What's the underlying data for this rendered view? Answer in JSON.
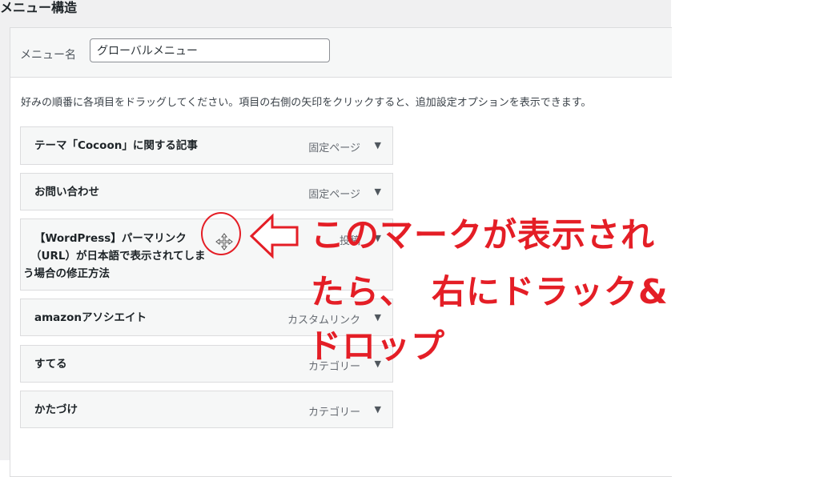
{
  "section_title": "メニュー構造",
  "menu_name": {
    "label": "メニュー名",
    "value": "グローバルメニュー"
  },
  "instructions": "好みの順番に各項目をドラッグしてください。項目の右側の矢印をクリックすると、追加設定オプションを表示できます。",
  "items": [
    {
      "title": "テーマ「Cocoon」に関する記事",
      "type": "固定ページ"
    },
    {
      "title": "お問い合わせ",
      "type": "固定ページ"
    },
    {
      "title_lines": [
        "【WordPress】パーマリンク",
        "（URL）が日本語で表示されてしま",
        "う場合の修正方法"
      ],
      "type": "投稿"
    },
    {
      "title": "amazonアソシエイト",
      "type": "カスタムリンク"
    },
    {
      "title": "すてる",
      "type": "カテゴリー"
    },
    {
      "title": "かたづけ",
      "type": "カテゴリー"
    }
  ],
  "annotation": {
    "lines": [
      "このマークが表示され",
      "たら、　右にドラック&",
      "ドロップ"
    ],
    "color": "#e41e26"
  },
  "icons": {
    "toggle": "chevron-down-icon",
    "move": "move-cursor-icon"
  }
}
